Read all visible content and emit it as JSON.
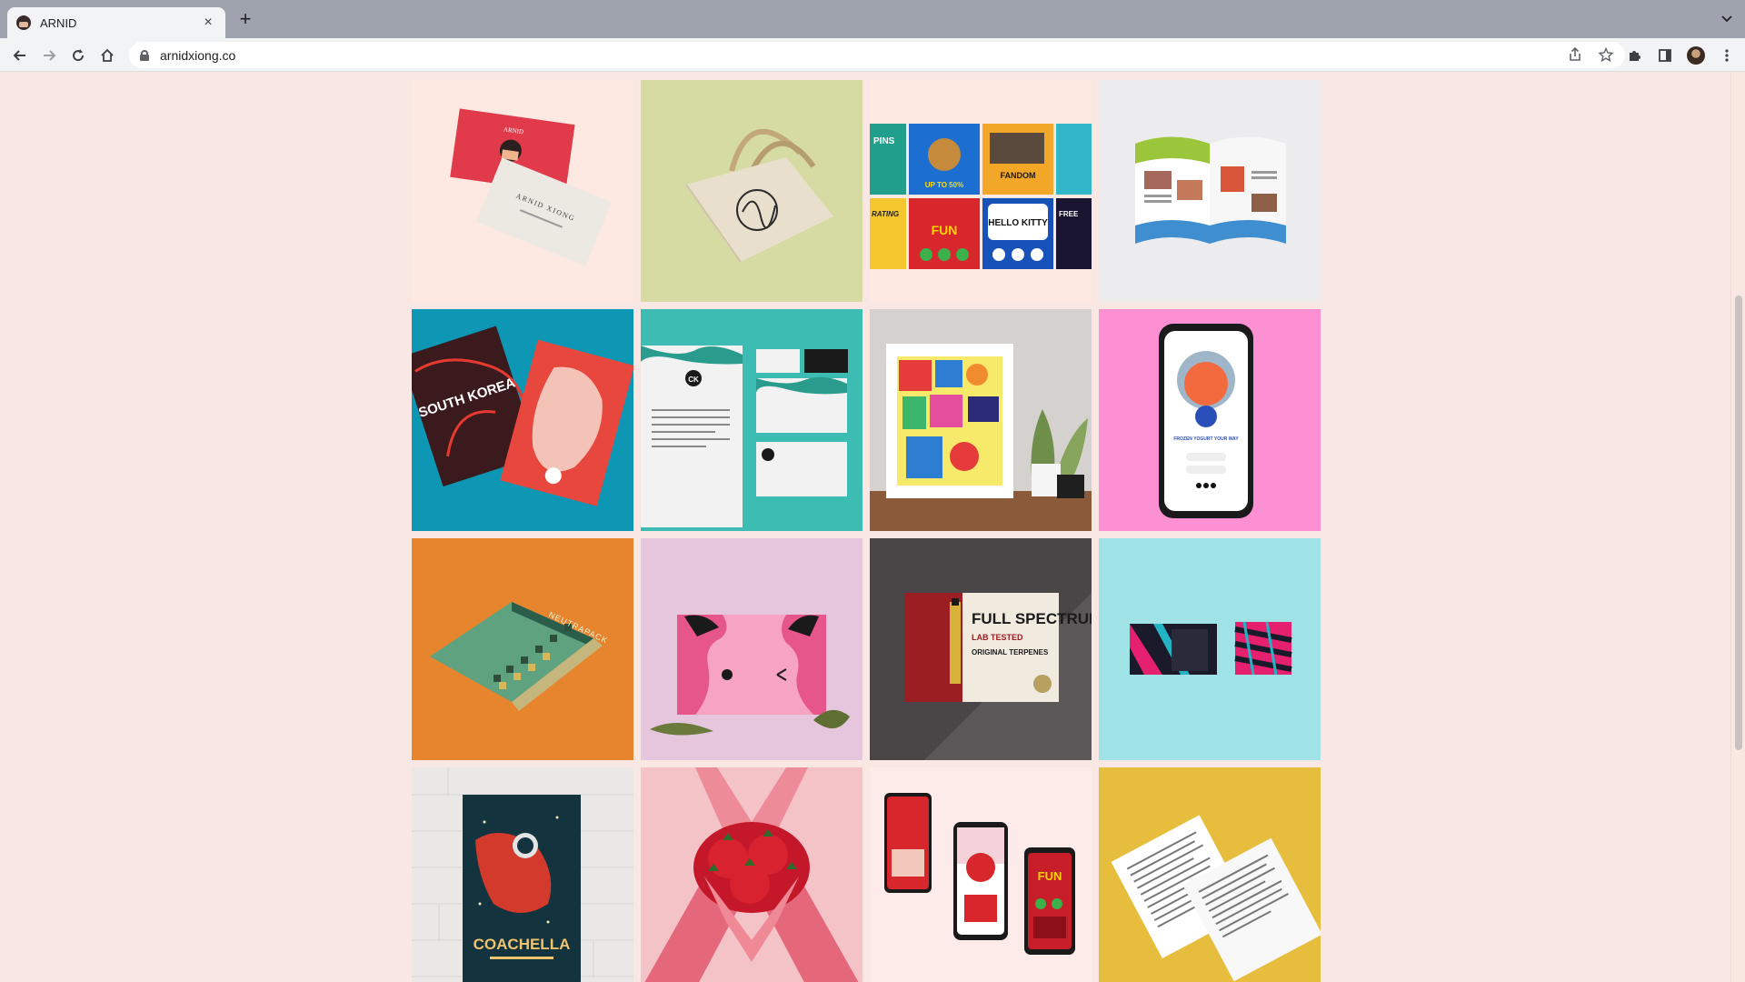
{
  "browser": {
    "tab_title": "ARNID",
    "tab_close": "×",
    "new_tab": "+",
    "url": "arnidxiong.co",
    "icons": [
      "back-arrow-icon",
      "forward-arrow-icon",
      "reload-icon",
      "home-icon",
      "lock-icon",
      "share-icon",
      "bookmark-star-icon",
      "extensions-puzzle-icon",
      "side-panel-icon",
      "profile-avatar",
      "kebab-menu-icon",
      "tab-list-chevron-icon"
    ]
  },
  "colors": {
    "page_bg": "#f9e7e3",
    "tabbar_bg": "#9ea3ae",
    "toolbar_bg": "#f1f3f4"
  },
  "gallery": {
    "tiles": [
      {
        "name": "business-cards",
        "bg": "#fde8e2",
        "text": [
          "ARNID",
          "ARNID XIONG"
        ]
      },
      {
        "name": "tote-bag",
        "bg": "#d6dba3"
      },
      {
        "name": "pins-banners",
        "bg": "#fde8e2",
        "text": [
          "PINS",
          "UP TO 50%",
          "FANDOM",
          "RATING",
          "FUN",
          "HELLO KITTY",
          "FREE"
        ]
      },
      {
        "name": "magazine-spread",
        "bg": "#ecebed"
      },
      {
        "name": "south-korea-posters",
        "bg": "#0d97b5",
        "text": [
          "SOUTH KOREA"
        ]
      },
      {
        "name": "ck-stationery",
        "bg": "#3dbcb3",
        "text": [
          "CK"
        ]
      },
      {
        "name": "framed-geometric-art",
        "bg": "#d4d1ce"
      },
      {
        "name": "frozen-yogurt-app",
        "bg": "#fd8fd3",
        "text": [
          "FROZEN YOGURT YOUR WAY"
        ]
      },
      {
        "name": "geometric-book",
        "bg": "#e6852d",
        "text": [
          "NEUTRAPACK"
        ]
      },
      {
        "name": "pink-faces-card",
        "bg": "#e6c6dd"
      },
      {
        "name": "full-spectrum-ad",
        "bg": "#5c5859",
        "text": [
          "FULL SPECTRUM",
          "LAB TESTED",
          "ORIGINAL TERPENES"
        ]
      },
      {
        "name": "pattern-books",
        "bg": "#9fe3e6"
      },
      {
        "name": "coachella-poster",
        "bg": "#e9e8e6",
        "text": [
          "COACHELLA"
        ]
      },
      {
        "name": "strawberry-hands",
        "bg": "#f4c3c7"
      },
      {
        "name": "phone-mockups",
        "bg": "#fdebea",
        "text": [
          "FUN"
        ]
      },
      {
        "name": "letter-papers",
        "bg": "#e7bd3d"
      }
    ]
  }
}
